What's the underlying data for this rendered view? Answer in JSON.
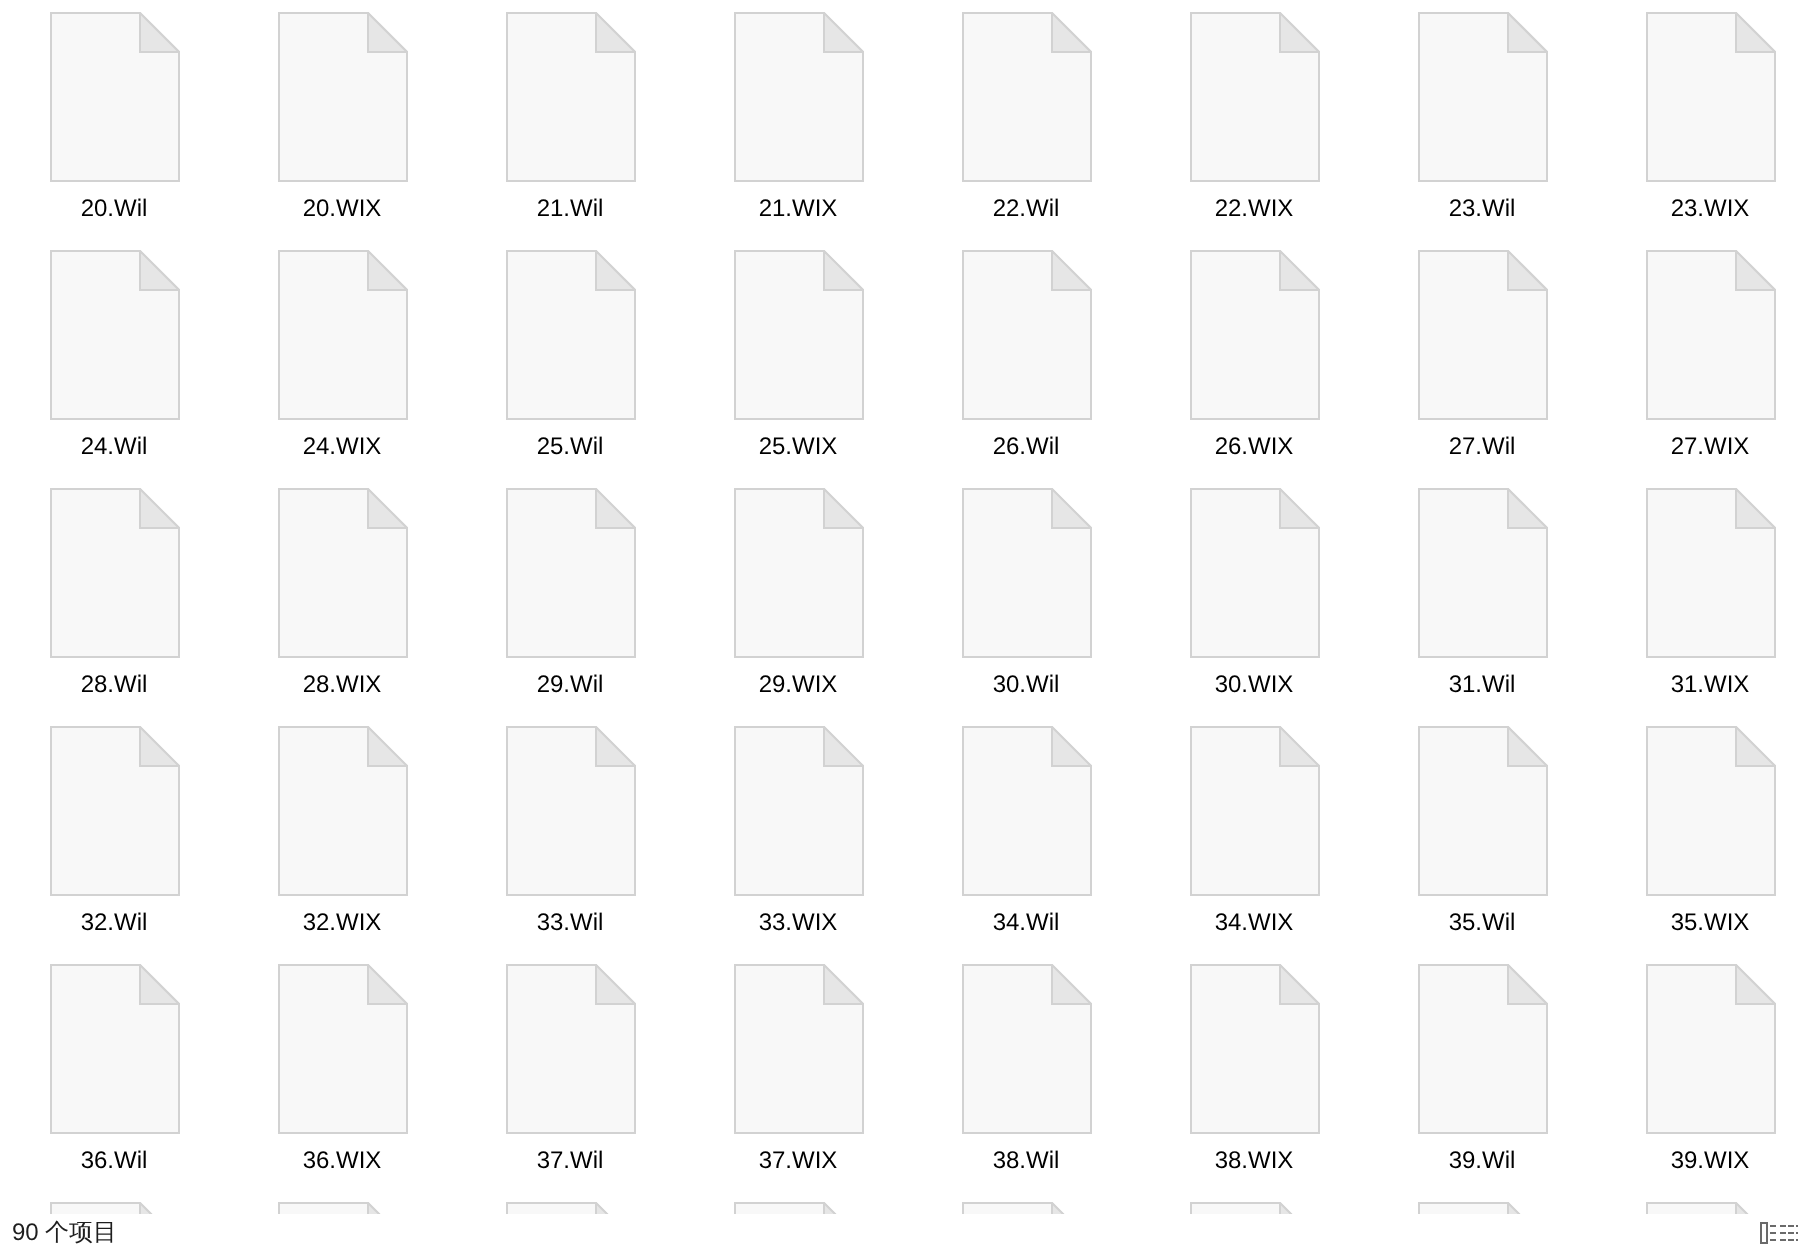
{
  "files": [
    {
      "kind": "file",
      "name": "20.Wil"
    },
    {
      "kind": "file",
      "name": "20.WIX"
    },
    {
      "kind": "file",
      "name": "21.Wil"
    },
    {
      "kind": "file",
      "name": "21.WIX"
    },
    {
      "kind": "file",
      "name": "22.Wil"
    },
    {
      "kind": "file",
      "name": "22.WIX"
    },
    {
      "kind": "file",
      "name": "23.Wil"
    },
    {
      "kind": "file",
      "name": "23.WIX"
    },
    {
      "kind": "file",
      "name": "24.Wil"
    },
    {
      "kind": "file",
      "name": "24.WIX"
    },
    {
      "kind": "file",
      "name": "25.Wil"
    },
    {
      "kind": "file",
      "name": "25.WIX"
    },
    {
      "kind": "file",
      "name": "26.Wil"
    },
    {
      "kind": "file",
      "name": "26.WIX"
    },
    {
      "kind": "file",
      "name": "27.Wil"
    },
    {
      "kind": "file",
      "name": "27.WIX"
    },
    {
      "kind": "file",
      "name": "28.Wil"
    },
    {
      "kind": "file",
      "name": "28.WIX"
    },
    {
      "kind": "file",
      "name": "29.Wil"
    },
    {
      "kind": "file",
      "name": "29.WIX"
    },
    {
      "kind": "file",
      "name": "30.Wil"
    },
    {
      "kind": "file",
      "name": "30.WIX"
    },
    {
      "kind": "file",
      "name": "31.Wil"
    },
    {
      "kind": "file",
      "name": "31.WIX"
    },
    {
      "kind": "file",
      "name": "32.Wil"
    },
    {
      "kind": "file",
      "name": "32.WIX"
    },
    {
      "kind": "file",
      "name": "33.Wil"
    },
    {
      "kind": "file",
      "name": "33.WIX"
    },
    {
      "kind": "file",
      "name": "34.Wil"
    },
    {
      "kind": "file",
      "name": "34.WIX"
    },
    {
      "kind": "file",
      "name": "35.Wil"
    },
    {
      "kind": "file",
      "name": "35.WIX"
    },
    {
      "kind": "file",
      "name": "36.Wil"
    },
    {
      "kind": "file",
      "name": "36.WIX"
    },
    {
      "kind": "file",
      "name": "37.Wil"
    },
    {
      "kind": "file",
      "name": "37.WIX"
    },
    {
      "kind": "file",
      "name": "38.Wil"
    },
    {
      "kind": "file",
      "name": "38.WIX"
    },
    {
      "kind": "file",
      "name": "39.Wil"
    },
    {
      "kind": "file",
      "name": "39.WIX"
    },
    {
      "kind": "file"
    },
    {
      "kind": "file"
    },
    {
      "kind": "file"
    },
    {
      "kind": "file"
    },
    {
      "kind": "file"
    },
    {
      "kind": "file"
    },
    {
      "kind": "file"
    },
    {
      "kind": "file"
    }
  ],
  "status_bar": {
    "item_count": "90 个项目"
  }
}
